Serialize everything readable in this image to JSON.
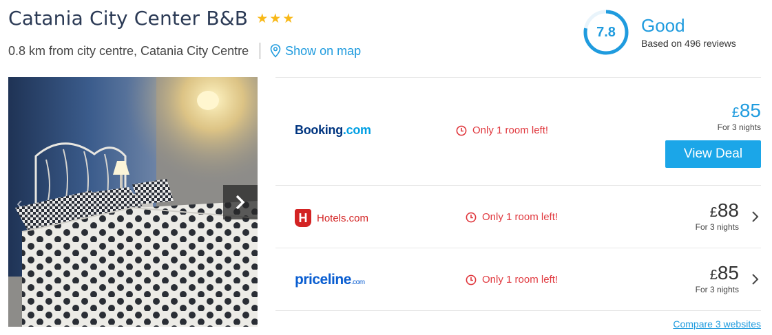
{
  "hotel": {
    "name": "Catania City Center B&B",
    "stars": 3,
    "location": "0.8 km from city centre, Catania City Centre",
    "map_link": "Show on map"
  },
  "rating": {
    "score": "7.8",
    "score_fraction": 0.78,
    "label": "Good",
    "reviews": "Based on 496 reviews"
  },
  "deals": [
    {
      "provider": "Booking.com",
      "provider_main": "Booking",
      "provider_suffix": ".com",
      "alert": "Only 1 room left!",
      "currency": "£",
      "price": "85",
      "nights": "For 3 nights",
      "cta": "View Deal"
    },
    {
      "provider": "Hotels.com",
      "provider_main": "Hotels.com",
      "provider_suffix": "",
      "alert": "Only 1 room left!",
      "currency": "£",
      "price": "88",
      "nights": "For 3 nights"
    },
    {
      "provider": "priceline.com",
      "provider_main": "priceline",
      "provider_suffix": ".com",
      "alert": "Only 1 room left!",
      "currency": "£",
      "price": "85",
      "nights": "For 3 nights"
    }
  ],
  "compare_link": "Compare 3 websites",
  "colors": {
    "accent": "#1f9bde",
    "button": "#1ba6e8",
    "alert": "#e0383e",
    "star": "#f8b817",
    "title": "#2b3a55"
  },
  "icons": {
    "map": "map-pin-icon",
    "alert": "clock-icon",
    "carousel_next": "chevron-right-icon",
    "row_chevron": "chevron-right-icon"
  }
}
